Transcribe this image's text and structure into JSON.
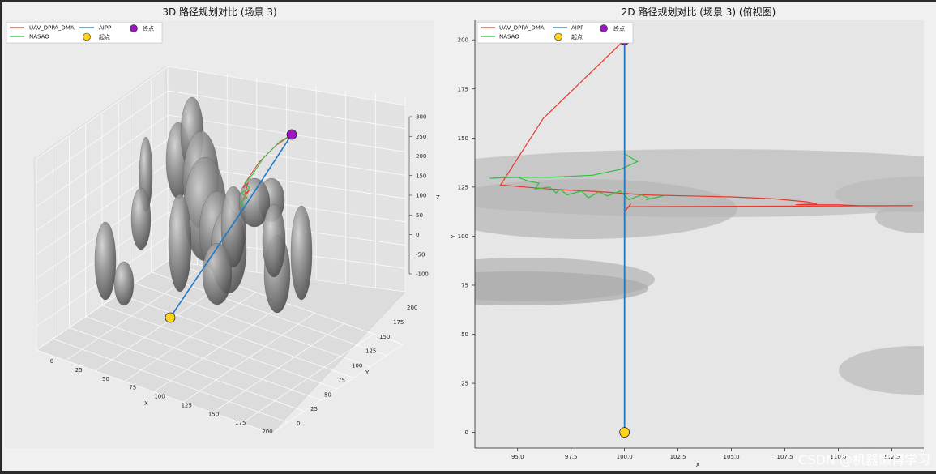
{
  "watermark": "CSDN @机器懒得学习",
  "legend": {
    "series": [
      {
        "name": "UAV_DPPA_DMA",
        "color": "#e8372c"
      },
      {
        "name": "NASAO",
        "color": "#2cc23a"
      },
      {
        "name": "AIPP",
        "color": "#1f77c4"
      }
    ],
    "markers": [
      {
        "name": "起点",
        "color": "#ffd21e"
      },
      {
        "name": "终点",
        "color": "#9c17c2"
      }
    ]
  },
  "chart_data": [
    {
      "type": "line",
      "title": "3D 路径规划对比 (场景 3)",
      "xlabel": "X",
      "ylabel": "Y",
      "zlabel": "Z",
      "x_ticks": [
        "0",
        "25",
        "50",
        "75",
        "100",
        "125",
        "150",
        "175",
        "200"
      ],
      "y_ticks": [
        "0",
        "25",
        "50",
        "75",
        "100",
        "125",
        "150",
        "175",
        "200"
      ],
      "z_ticks": [
        "-100",
        "-50",
        "0",
        "50",
        "100",
        "150",
        "200",
        "250",
        "300"
      ],
      "xlim": [
        0,
        200
      ],
      "ylim": [
        0,
        200
      ],
      "zlim": [
        -100,
        300
      ],
      "start": {
        "x": 100,
        "y": 0,
        "z": 0
      },
      "goal": {
        "x": 100,
        "y": 200,
        "z": 250
      },
      "legend_position": "top-left",
      "grid": true
    },
    {
      "type": "line",
      "title": "2D 路径规划对比 (场景 3) (俯视图)",
      "xlabel": "X",
      "ylabel": "Y",
      "x_ticks": [
        "95.0",
        "97.5",
        "100.0",
        "102.5",
        "105.0",
        "107.5",
        "110.0",
        "112.5"
      ],
      "y_ticks": [
        "0",
        "25",
        "50",
        "75",
        "100",
        "125",
        "150",
        "175",
        "200"
      ],
      "xlim": [
        93.0,
        114.0
      ],
      "ylim": [
        -8,
        210
      ],
      "start": {
        "x": 100,
        "y": 0
      },
      "goal": {
        "x": 100,
        "y": 200
      },
      "legend_position": "top-left",
      "grid": false,
      "series": [
        {
          "name": "UAV_DPPA_DMA",
          "color": "#e8372c",
          "points": [
            [
              100,
              200
            ],
            [
              96.2,
              160
            ],
            [
              94.2,
              126
            ],
            [
              96.5,
              124
            ],
            [
              99,
              122.5
            ],
            [
              101,
              121
            ],
            [
              103,
              120.5
            ],
            [
              105,
              120
            ],
            [
              107,
              119
            ],
            [
              108.5,
              117.5
            ],
            [
              109,
              116.5
            ],
            [
              108,
              116
            ],
            [
              110,
              116
            ],
            [
              111,
              115.5
            ],
            [
              113.5,
              115.5
            ],
            [
              100.2,
              115
            ],
            [
              100,
              112.5
            ],
            [
              100.3,
              116.5
            ]
          ]
        },
        {
          "name": "NASAO",
          "color": "#2cc23a",
          "points": [
            [
              100,
              152
            ],
            [
              100,
              142
            ],
            [
              100.6,
              138
            ],
            [
              99.8,
              134
            ],
            [
              98.5,
              131
            ],
            [
              96.5,
              130
            ],
            [
              94.5,
              130
            ],
            [
              93.7,
              129.5
            ],
            [
              95,
              130
            ],
            [
              95.5,
              128
            ],
            [
              96,
              127
            ],
            [
              95.8,
              124
            ],
            [
              96.5,
              125
            ],
            [
              96.8,
              122
            ],
            [
              97,
              124
            ],
            [
              97.3,
              121
            ],
            [
              98,
              123
            ],
            [
              98.3,
              119.5
            ],
            [
              98.8,
              122.5
            ],
            [
              99.2,
              120.5
            ],
            [
              99.8,
              123
            ],
            [
              100.2,
              118.5
            ],
            [
              100.8,
              121
            ],
            [
              101.2,
              119
            ],
            [
              101.8,
              120.5
            ],
            [
              101,
              118.5
            ]
          ]
        },
        {
          "name": "AIPP",
          "color": "#1f77c4",
          "points": [
            [
              100,
              0
            ],
            [
              100,
              200
            ]
          ]
        }
      ]
    }
  ]
}
